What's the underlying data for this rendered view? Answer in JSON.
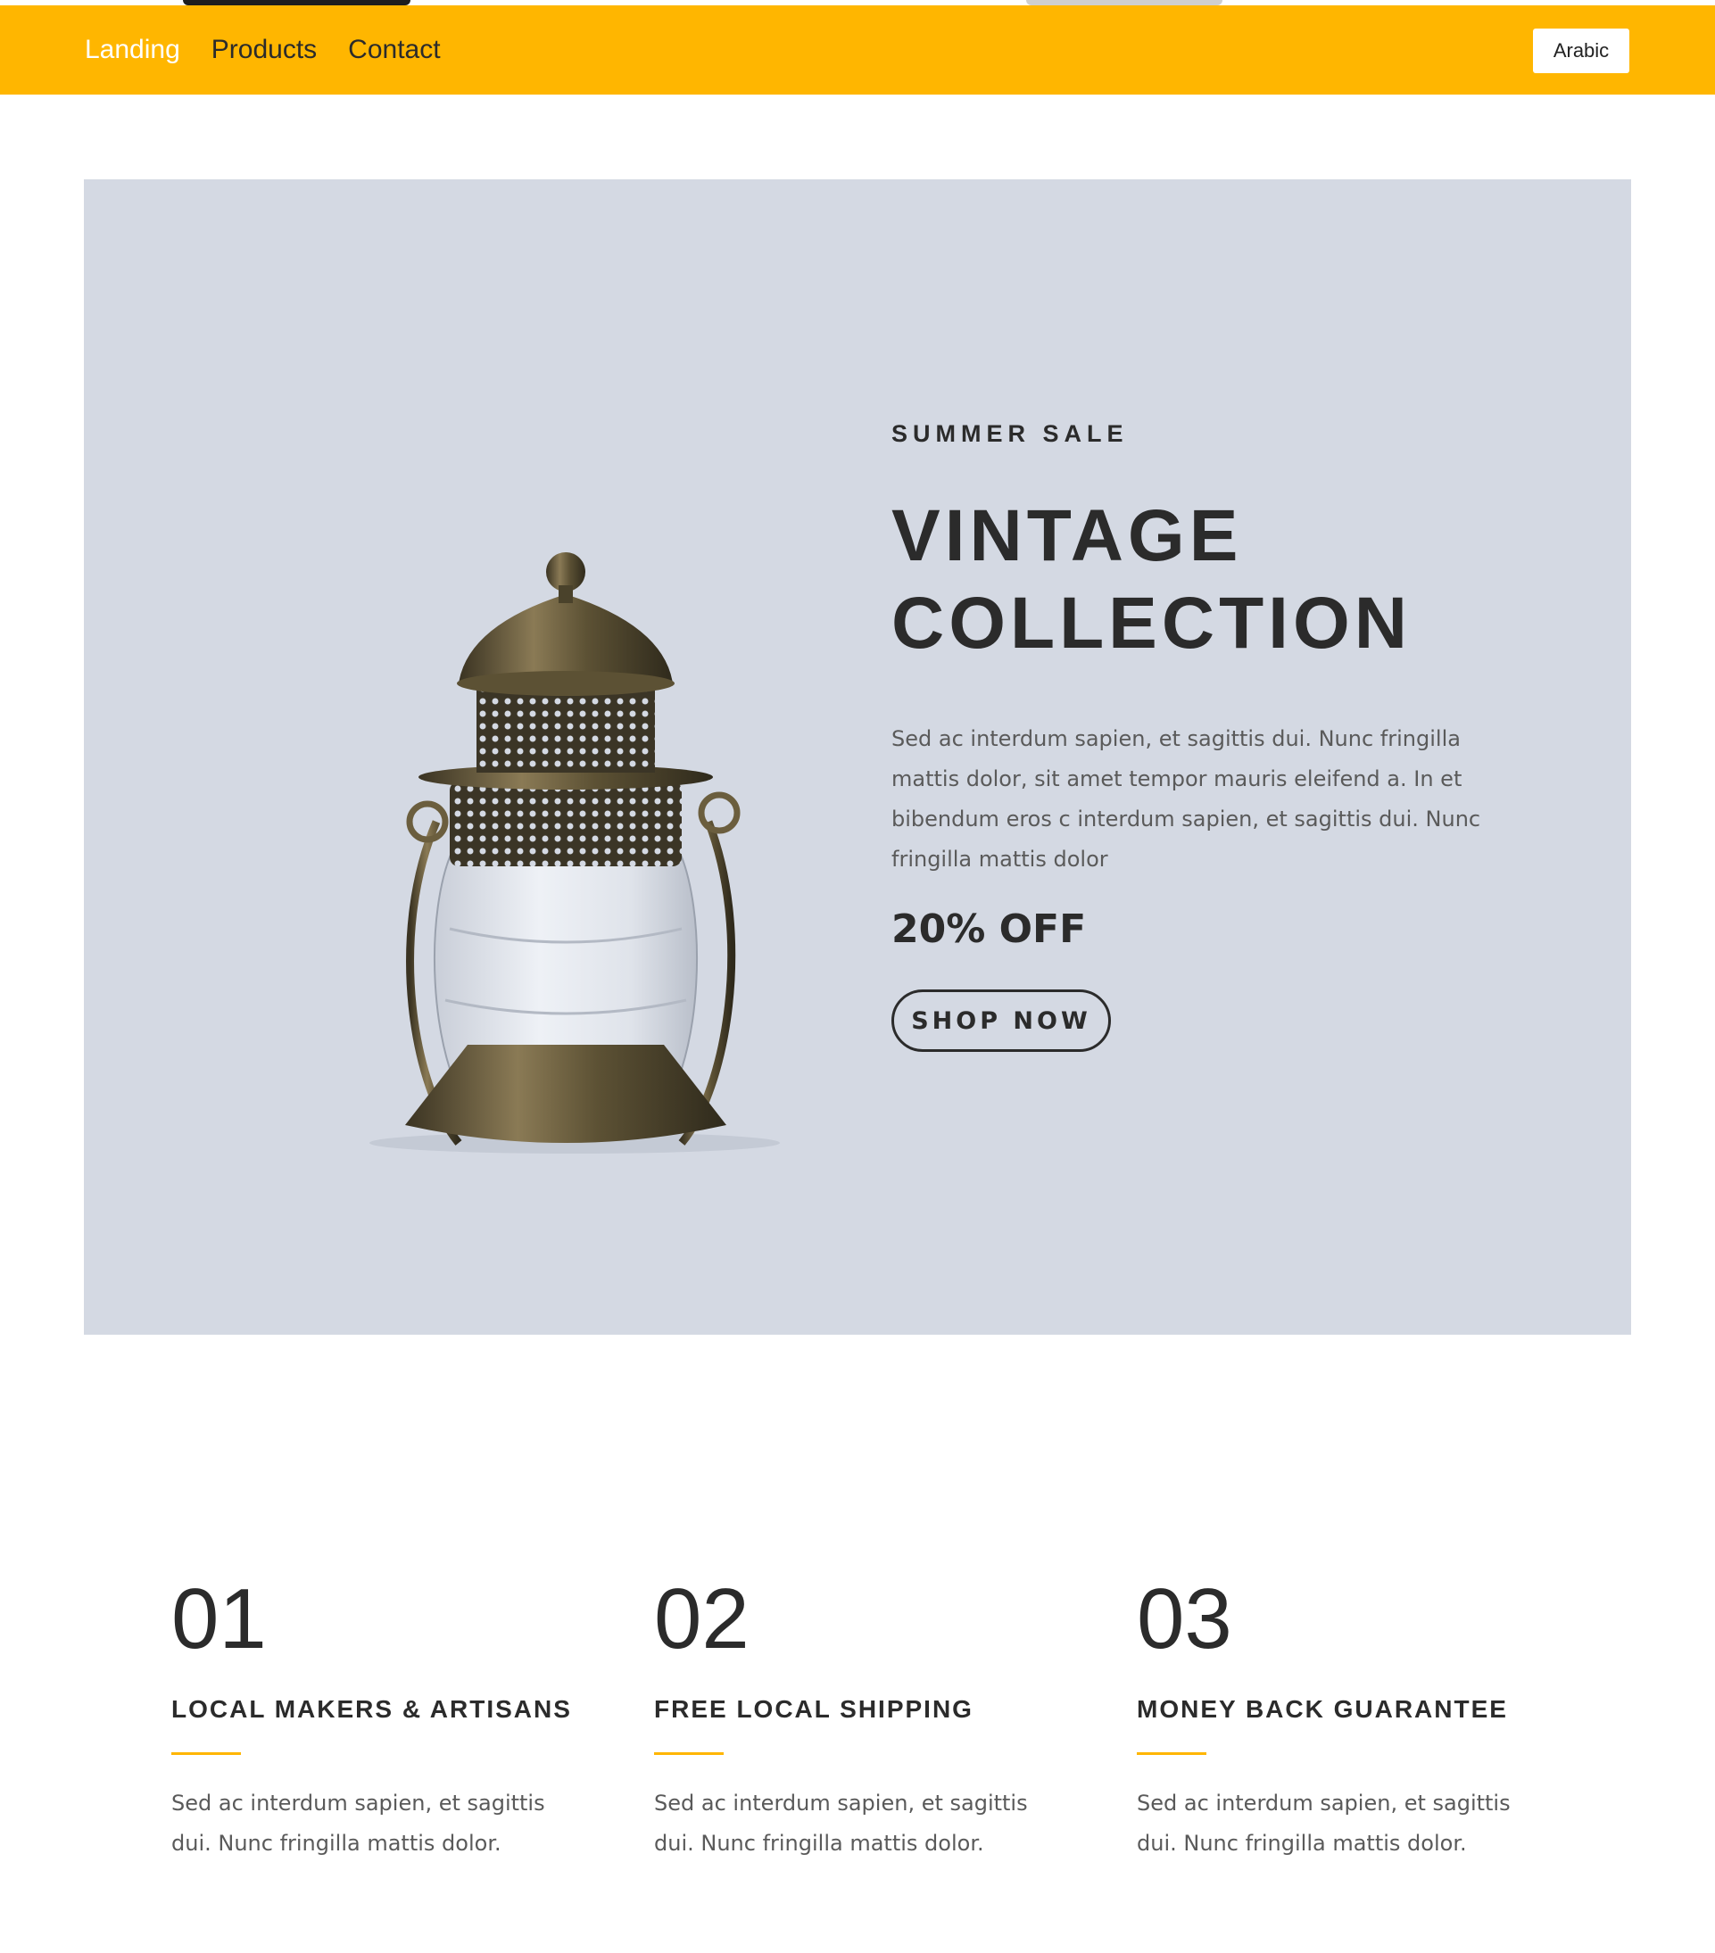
{
  "nav": {
    "links": [
      "Landing",
      "Products",
      "Contact"
    ],
    "active": "Landing",
    "language_button": "Arabic"
  },
  "hero": {
    "eyebrow": "SUMMER SALE",
    "title_line1": "VINTAGE",
    "title_line2": "COLLECTION",
    "description": "Sed ac interdum sapien, et sagittis dui. Nunc fringilla mattis dolor, sit amet tempor mauris eleifend a. In et bibendum eros c interdum sapien, et sagittis dui. Nunc fringilla mattis dolor",
    "discount": "20% OFF",
    "cta": "SHOP NOW",
    "image_icon": "lantern-image"
  },
  "features": [
    {
      "number": "01",
      "title": "LOCAL MAKERS & ARTISANS",
      "text": "Sed ac interdum sapien, et sagittis dui. Nunc fringilla mattis dolor."
    },
    {
      "number": "02",
      "title": "FREE LOCAL SHIPPING",
      "text": "Sed ac interdum sapien, et sagittis dui. Nunc fringilla mattis dolor."
    },
    {
      "number": "03",
      "title": "MONEY BACK GUARANTEE",
      "text": "Sed ac interdum sapien, et sagittis dui. Nunc fringilla mattis dolor."
    }
  ],
  "colors": {
    "accent": "#ffb600",
    "hero_bg": "#d4d9e3",
    "text_dark": "#2b2b2b",
    "text_muted": "#5a5a5a"
  }
}
